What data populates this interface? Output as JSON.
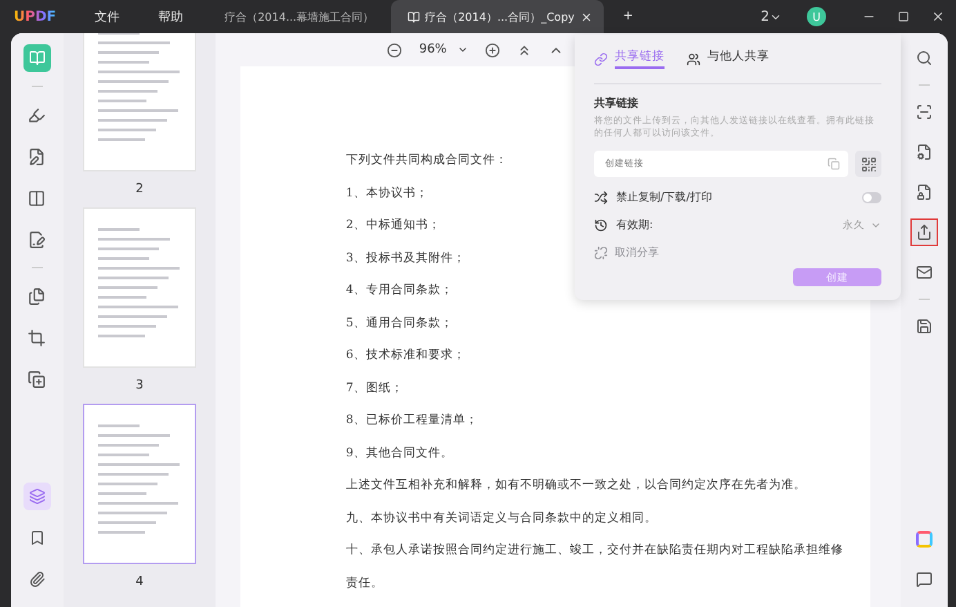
{
  "app": {
    "logo": "UPDF",
    "menu": [
      "文件",
      "帮助"
    ]
  },
  "tabs": [
    {
      "title": "疗合（2014...幕墙施工合同）",
      "selected": false
    },
    {
      "title": "疗合（2014）...合同）_Copy",
      "selected": true
    }
  ],
  "new_tab": "+",
  "page_count": "2",
  "avatar": "U",
  "toolbar": {
    "zoom": "96%"
  },
  "thumbnails": [
    {
      "label": "2",
      "selected": false
    },
    {
      "label": "3",
      "selected": false
    },
    {
      "label": "4",
      "selected": true
    }
  ],
  "document": {
    "lines": [
      "下列文件共同构成合同文件：",
      "1、本协议书；",
      "2、中标通知书；",
      "3、投标书及其附件；",
      "4、专用合同条款；",
      "5、通用合同条款；",
      "6、技术标准和要求；",
      "7、图纸；",
      "8、已标价工程量清单；",
      "9、其他合同文件。",
      "上述文件互相补充和解释，如有不明确或不一致之处，以合同约定次序在先者为准。",
      "九、本协议书中有关词语定义与合同条款中的定义相同。",
      "十、承包人承诺按照合同约定进行施工、竣工，交付并在缺陷责任期内对工程缺陷承担维修",
      "责任。"
    ]
  },
  "share_panel": {
    "tabs": [
      {
        "label": "共享链接",
        "selected": true
      },
      {
        "label": "与他人共享",
        "selected": false
      }
    ],
    "heading": "共享链接",
    "description": "将您的文件上传到云，向其他人发送链接以在线查看。拥有此链接的任何人都可以访问该文件。",
    "link_field": {
      "placeholder": "创建链接"
    },
    "restrict": {
      "label": "禁止复制/下载/打印",
      "on": false
    },
    "validity": {
      "label": "有效期:",
      "value": "永久"
    },
    "cancel_share": {
      "label": "取消分享",
      "disabled": true
    },
    "create_button": "创建"
  },
  "right_tools": [
    {
      "kind": "search",
      "highlighted": false
    },
    {
      "kind": "ocr",
      "highlighted": false
    },
    {
      "kind": "convert",
      "highlighted": false
    },
    {
      "kind": "protect",
      "highlighted": false
    },
    {
      "kind": "share",
      "highlighted": true
    },
    {
      "kind": "mail",
      "highlighted": false
    },
    {
      "kind": "save",
      "highlighted": false
    }
  ]
}
